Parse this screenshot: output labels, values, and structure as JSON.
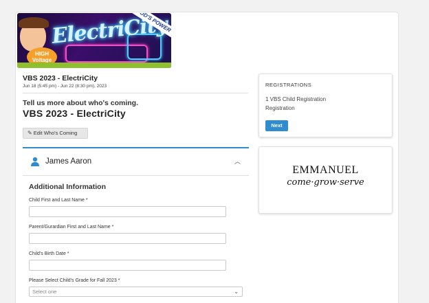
{
  "banner": {
    "title": "ElectriCity",
    "sash": "GOD'S POWER",
    "badge_line1": "HIGH",
    "badge_line2": "Voltage"
  },
  "event": {
    "title": "VBS 2023 - ElectriCity",
    "dates": "Jun 18 (5:45 pm) - Jun 22 (8:30 pm), 2023"
  },
  "main": {
    "prompt": "Tell us more about who's coming.",
    "title": "VBS 2023 - ElectriCity",
    "edit_button": "Edit Who's Coming"
  },
  "registrant": {
    "name": "James Aaron"
  },
  "form": {
    "section_title": "Additional Information",
    "fields": [
      {
        "label": "Child First and Last Name *",
        "value": ""
      },
      {
        "label": "Parent/Gurardian First and Last Name *",
        "value": ""
      },
      {
        "label": "Child's Birth Date *",
        "value": ""
      }
    ],
    "grade_label": "Please Select Child's Grade for Fall 2023 *",
    "grade_selected": "Select one"
  },
  "registrations": {
    "heading": "REGISTRATIONS",
    "line1": "1 VBS Child Registration",
    "line2": "Registration",
    "next_button": "Next"
  },
  "church_logo": {
    "name": "EMMANUEL",
    "tagline": "come·grow·serve"
  },
  "colors": {
    "accent": "#2e8ccf",
    "page_background": "#f2f2f3"
  }
}
